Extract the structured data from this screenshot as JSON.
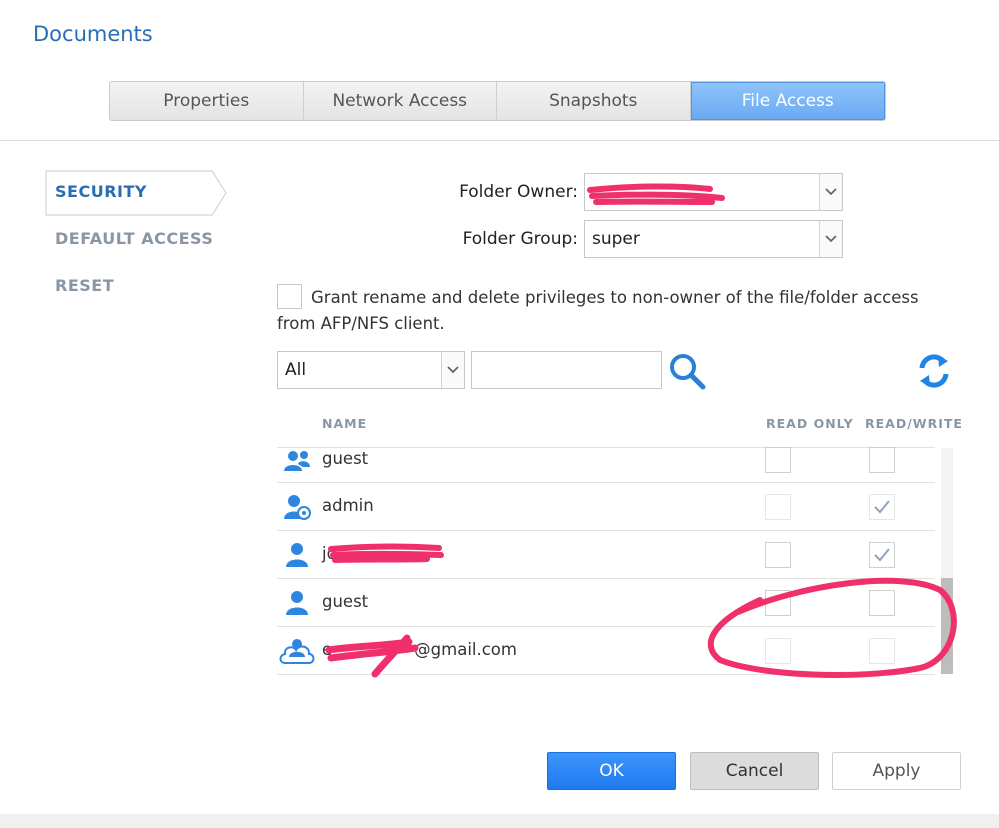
{
  "window": {
    "title": "Documents"
  },
  "tabs": [
    {
      "label": "Properties",
      "active": false
    },
    {
      "label": "Network Access",
      "active": false
    },
    {
      "label": "Snapshots",
      "active": false
    },
    {
      "label": "File Access",
      "active": true
    }
  ],
  "sidebar": {
    "items": [
      {
        "label": "SECURITY",
        "active": true
      },
      {
        "label": "DEFAULT ACCESS",
        "active": false
      },
      {
        "label": "RESET",
        "active": false
      }
    ]
  },
  "form": {
    "owner_label": "Folder Owner:",
    "owner_value": "",
    "group_label": "Folder Group:",
    "group_value": "super",
    "grant_text": "Grant rename and delete privileges to non-owner of the file/folder access from AFP/NFS client.",
    "grant_checked": false
  },
  "filter": {
    "selected": "All",
    "search_value": "",
    "search_icon": "search-icon",
    "refresh_icon": "refresh-icon"
  },
  "table": {
    "columns": {
      "name": "NAME",
      "read_only": "READ ONLY",
      "read_write": "READ/WRITE"
    },
    "rows": [
      {
        "name": "guest",
        "icon": "user-group-icon",
        "read_only": false,
        "read_write": false,
        "disabled": false
      },
      {
        "name": "admin",
        "icon": "admin-user-icon",
        "read_only": false,
        "read_write": true,
        "disabled": true
      },
      {
        "name": "jo",
        "icon": "user-icon",
        "read_only": false,
        "read_write": true,
        "disabled": false
      },
      {
        "name": "guest",
        "icon": "user-icon",
        "read_only": false,
        "read_write": false,
        "disabled": false
      },
      {
        "name": "e@gmail.com",
        "name_visible_suffix": "@gmail.com",
        "name_visible_prefix": "e",
        "icon": "cloud-user-icon",
        "read_only": false,
        "read_write": false,
        "disabled": true
      }
    ]
  },
  "buttons": {
    "ok": "OK",
    "cancel": "Cancel",
    "apply": "Apply"
  },
  "colors": {
    "accent": "#2a6db5",
    "primary_button": "#2a85f5",
    "annotation": "#f0306a"
  }
}
